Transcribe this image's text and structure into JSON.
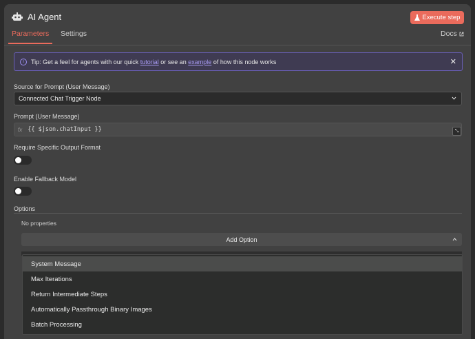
{
  "header": {
    "title": "AI Agent",
    "execute_label": "Execute step",
    "tabs": [
      {
        "label": "Parameters",
        "active": true
      },
      {
        "label": "Settings",
        "active": false
      }
    ],
    "docs_label": "Docs"
  },
  "tip": {
    "prefix": "Tip: Get a feel for agents with our quick ",
    "link1": "tutorial",
    "middle": " or see an ",
    "link2": "example",
    "suffix": " of how this node works"
  },
  "source": {
    "label": "Source for Prompt (User Message)",
    "value": "Connected Chat Trigger Node"
  },
  "prompt": {
    "label": "Prompt (User Message)",
    "fx": "fx",
    "expression": "{{ $json.chatInput }}"
  },
  "require_output": {
    "label": "Require Specific Output Format",
    "enabled": false
  },
  "fallback": {
    "label": "Enable Fallback Model",
    "enabled": false
  },
  "options": {
    "label": "Options",
    "empty_text": "No properties",
    "add_label": "Add Option",
    "items": [
      {
        "label": "System Message",
        "highlighted": true
      },
      {
        "label": "Max Iterations",
        "highlighted": false
      },
      {
        "label": "Return Intermediate Steps",
        "highlighted": false
      },
      {
        "label": "Automatically Passthrough Binary Images",
        "highlighted": false
      },
      {
        "label": "Batch Processing",
        "highlighted": false
      }
    ]
  },
  "colors": {
    "accent": "#ea6b5c",
    "tip_border": "#6a5fb8",
    "link": "#a99cf5"
  }
}
